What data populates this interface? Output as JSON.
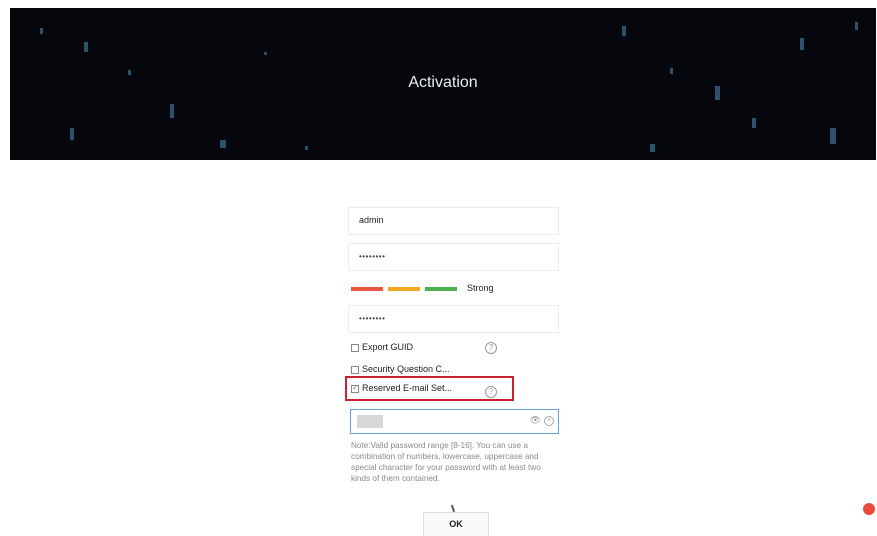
{
  "header": {
    "title": "Activation"
  },
  "form": {
    "username_value": "admin",
    "password_mask": "••••••••",
    "confirm_mask": "••••••••",
    "strength_label": "Strong",
    "strength_colors": [
      "#e8563e",
      "#f5a623",
      "#4caf50"
    ],
    "export_guid_label": "Export GUID",
    "security_question_label": "Security Question C...",
    "reserved_email_label": "Reserved E-mail Set...",
    "reserved_email_checked": true,
    "help_icon": "?",
    "eye_icon": "👁",
    "clear_icon": "×",
    "note": "Note:Valid password range [8-16]. You can use a combination of numbers, lowercase, uppercase and special character for your password with at least two kinds of them contained.",
    "ok_label": "OK"
  }
}
